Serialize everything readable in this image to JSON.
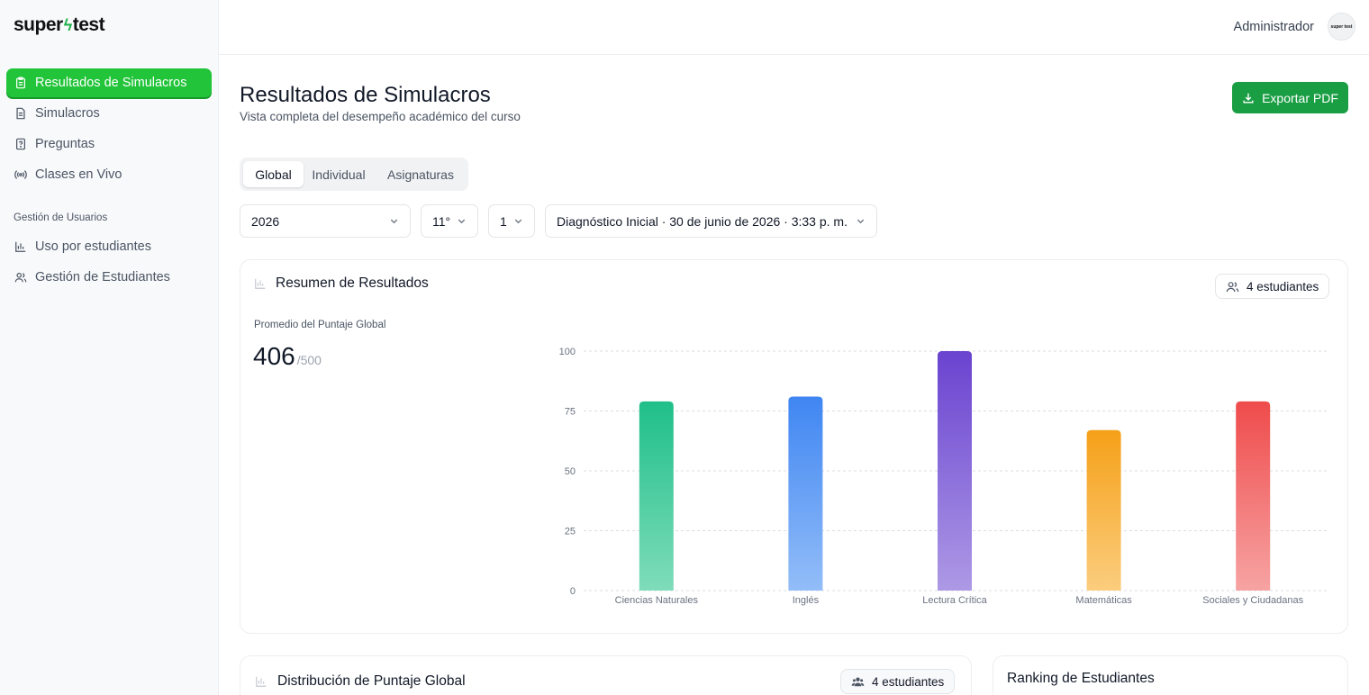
{
  "brand": {
    "name_left": "super",
    "bolt": "ϟ",
    "name_right": "test",
    "avatar_text": "super test"
  },
  "sidebar": {
    "items": [
      {
        "label": "Resultados de Simulacros",
        "icon": "clipboard-icon"
      },
      {
        "label": "Simulacros",
        "icon": "document-icon"
      },
      {
        "label": "Preguntas",
        "icon": "question-file-icon"
      },
      {
        "label": "Clases en Vivo",
        "icon": "broadcast-icon"
      }
    ],
    "section_title": "Gestión de Usuarios",
    "user_items": [
      {
        "label": "Uso por estudiantes",
        "icon": "bar-chart-icon"
      },
      {
        "label": "Gestión de Estudiantes",
        "icon": "users-icon"
      }
    ]
  },
  "header": {
    "user_name": "Administrador"
  },
  "page": {
    "title": "Resultados de Simulacros",
    "subtitle": "Vista completa del desempeño académico del curso",
    "export_label": "Exportar PDF"
  },
  "tabs": [
    {
      "label": "Global"
    },
    {
      "label": "Individual"
    },
    {
      "label": "Asignaturas"
    }
  ],
  "filters": {
    "year": "2026",
    "grade": "11°",
    "group": "1",
    "exam": "Diagnóstico Inicial · 30 de junio de 2026 · 3:33 p. m."
  },
  "summary": {
    "title": "Resumen de Resultados",
    "students_badge": "4 estudiantes",
    "metric_label": "Promedio del Puntaje Global",
    "metric_value": "406",
    "metric_max": "/500"
  },
  "chart_data": {
    "type": "bar",
    "categories": [
      "Ciencias Naturales",
      "Inglés",
      "Lectura Crítica",
      "Matemáticas",
      "Sociales y Ciudadanas"
    ],
    "values": [
      79,
      81,
      100,
      67,
      79
    ],
    "ylim": [
      0,
      100
    ],
    "yticks": [
      0,
      25,
      50,
      75,
      100
    ],
    "grid": true,
    "colors": [
      "#1fbf8a",
      "#3f86f2",
      "#6a43d0",
      "#f5a018",
      "#ef4b4b"
    ],
    "colors_light": [
      "#7fdcba",
      "#93bdf8",
      "#ad99e5",
      "#fbcd7e",
      "#f7a3a3"
    ]
  },
  "distribution": {
    "title": "Distribución de Puntaje Global",
    "students_badge": "4 estudiantes"
  },
  "ranking": {
    "title": "Ranking de Estudiantes"
  },
  "colors": {
    "accent": "#22c43a",
    "export": "#1a9e44"
  }
}
